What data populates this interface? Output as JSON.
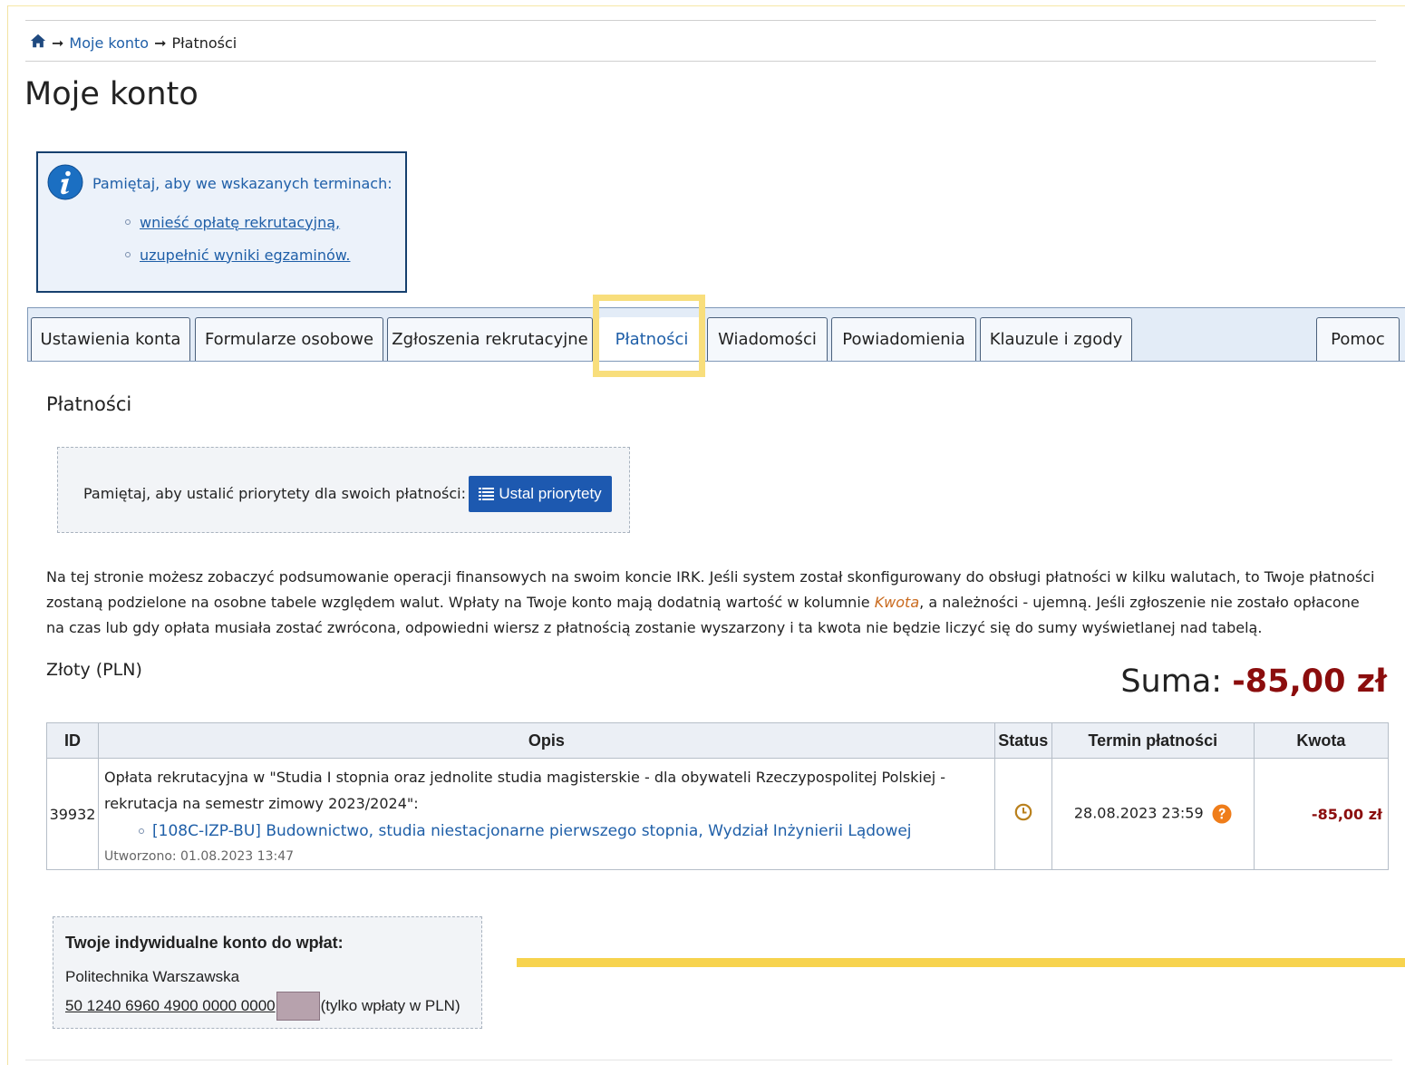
{
  "breadcrumb": {
    "home_icon": "home-icon",
    "separator": "➞",
    "items": [
      "Moje konto",
      "Płatności"
    ]
  },
  "page_title": "Moje konto",
  "info_box": {
    "icon": "info-icon",
    "text": "Pamiętaj, aby we wskazanych terminach:",
    "links": [
      "wnieść opłatę rekrutacyjną,",
      "uzupełnić wyniki egzaminów."
    ]
  },
  "tabs": [
    {
      "label": "Ustawienia konta",
      "active": false
    },
    {
      "label": "Formularze osobowe",
      "active": false
    },
    {
      "label": "Zgłoszenia rekrutacyjne",
      "active": false
    },
    {
      "label": "Płatności",
      "active": true
    },
    {
      "label": "Wiadomości",
      "active": false
    },
    {
      "label": "Powiadomienia",
      "active": false
    },
    {
      "label": "Klauzule i zgody",
      "active": false
    },
    {
      "label": "Pomoc",
      "active": false
    }
  ],
  "section_title": "Płatności",
  "priority": {
    "text": "Pamiętaj, aby ustalić priorytety dla swoich płatności:",
    "button_label": "Ustal priorytety",
    "button_icon": "list-icon"
  },
  "description": {
    "part1": "Na tej stronie możesz zobaczyć podsumowanie operacji finansowych na swoim koncie IRK. Jeśli system został skonfigurowany do obsługi płatności w kilku walutach, to Twoje płatności zostaną podzielone na osobne tabele względem walut. Wpłaty na Twoje konto mają dodatnią wartość w kolumnie ",
    "emph": "Kwota",
    "part2": ", a należności - ujemną. Jeśli zgłoszenie nie zostało opłacone na czas lub gdy opłata musiała zostać zwrócona, odpowiedni wiersz z płatnością zostanie wyszarzony i ta kwota nie będzie liczyć się do sumy wyświetlanej nad tabelą."
  },
  "currency_label": "Złoty (PLN)",
  "sum": {
    "label": "Suma:",
    "amount": "-85,00 zł"
  },
  "table": {
    "headers": [
      "ID",
      "Opis",
      "Status",
      "Termin płatności",
      "Kwota"
    ],
    "rows": [
      {
        "id": "39932",
        "opis_main": "Opłata rekrutacyjna w \"Studia I stopnia oraz jednolite studia magisterskie - dla obywateli Rzeczypospolitej Polskiej - rekrutacja na semestr zimowy 2023/2024\":",
        "opis_link": "[108C-IZP-BU] Budownictwo, studia niestacjonarne pierwszego stopnia, Wydział Inżynierii Lądowej",
        "created": "Utworzono: 01.08.2023 13:47",
        "status_icon": "clock-icon",
        "termin": "28.08.2023 23:59",
        "termin_icon": "help-icon",
        "kwota": "-85,00 zł"
      }
    ]
  },
  "account": {
    "title": "Twoje indywidualne konto do wpłat:",
    "bank": "Politechnika Warszawska",
    "number": "50 1240 6960 4900 0000 0000",
    "note": "(tylko wpłaty w PLN)"
  },
  "colors": {
    "link": "#1f5fa8",
    "button": "#1d59b0",
    "negative_amount": "#8b0d0d",
    "highlight": "#f8de7c",
    "info_border": "#16406e"
  }
}
